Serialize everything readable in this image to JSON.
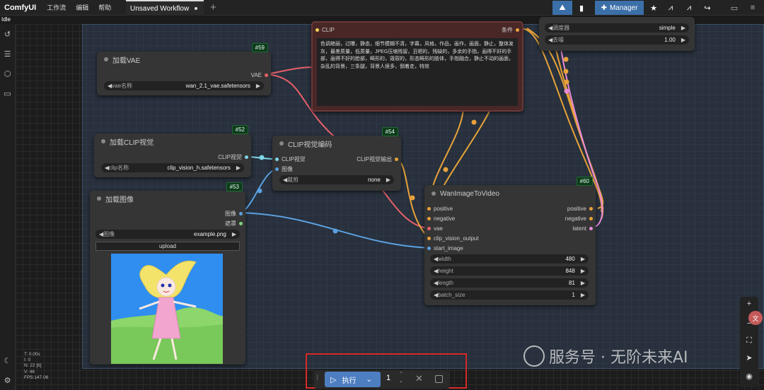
{
  "topbar": {
    "brand": "ComfyUI",
    "menu": [
      "工作流",
      "编辑",
      "帮助"
    ],
    "tab_title": "Unsaved Workflow",
    "manager_label": "Manager",
    "accent": "#3b6fa8"
  },
  "status": {
    "idle": "Idle"
  },
  "stats": {
    "t": "T: 0.00s",
    "i": "I: 0",
    "n": "N: 22 [6]",
    "v": "V: 46",
    "fps": "FPS:147.06"
  },
  "nodes": {
    "vae": {
      "badge": "#59",
      "title": "加载VAE",
      "output": "VAE",
      "widget_label": "vae名称",
      "widget_value": "wan_2.1_vae.safetensors"
    },
    "clip_text": {
      "input": "CLIP",
      "output": "条件",
      "text": "色调艳丽，过曝，静态，细节模糊不清，字幕，风格，作品，画作，画面，静止，整体发灰，最差质量，低质量，JPEG压缩残留，丑陋的，残缺的，多余的手指，画得不好的手部，画得不好的脸部，畸形的，毁容的，形态畸形的肢体，手指融合，静止不动的画面，杂乱的背景，三条腿，背景人很多，倒着走，特效"
    },
    "sampler": {
      "scheduler_label": "调度器",
      "scheduler_value": "simple",
      "denoise_label": "去噪",
      "denoise_value": "1.00"
    },
    "clip_vision_loader": {
      "badge": "#52",
      "title": "加载CLIP视觉",
      "output": "CLIP视觉",
      "widget_label": "clip名称",
      "widget_value": "clip_vision_h.safetensors"
    },
    "clip_vision_encode": {
      "badge": "#54",
      "title": "CLIP视觉编码",
      "input_clip": "CLIP视觉",
      "input_image": "图像",
      "output": "CLIP视觉输出",
      "widget_label": "裁剪",
      "widget_value": "none"
    },
    "load_image": {
      "badge": "#53",
      "title": "加载图像",
      "output_image": "图像",
      "output_mask": "遮罩",
      "widget_label": "图像",
      "widget_value": "example.png",
      "upload_label": "upload"
    },
    "wan": {
      "badge": "#60",
      "title": "WanImageToVideo",
      "inputs": [
        "positive",
        "negative",
        "vae",
        "clip_vision_output",
        "start_image"
      ],
      "outputs": [
        "positive",
        "negative",
        "latent"
      ],
      "widgets": [
        {
          "label": "width",
          "value": "480"
        },
        {
          "label": "height",
          "value": "848"
        },
        {
          "label": "length",
          "value": "81"
        },
        {
          "label": "batch_size",
          "value": "1"
        }
      ]
    }
  },
  "runbar": {
    "run_label": "执行",
    "batch_count": "1"
  },
  "watermark": "服务号 · 无阶未来AI",
  "colors": {
    "link_orange": "#e8a23a",
    "link_red": "#e5606a",
    "link_blue": "#5aa0e0",
    "link_cyan": "#7fd6e8",
    "link_pink": "#e88ad9",
    "run_blue": "#4e7ec2",
    "highlight_red": "#d62a2a"
  }
}
